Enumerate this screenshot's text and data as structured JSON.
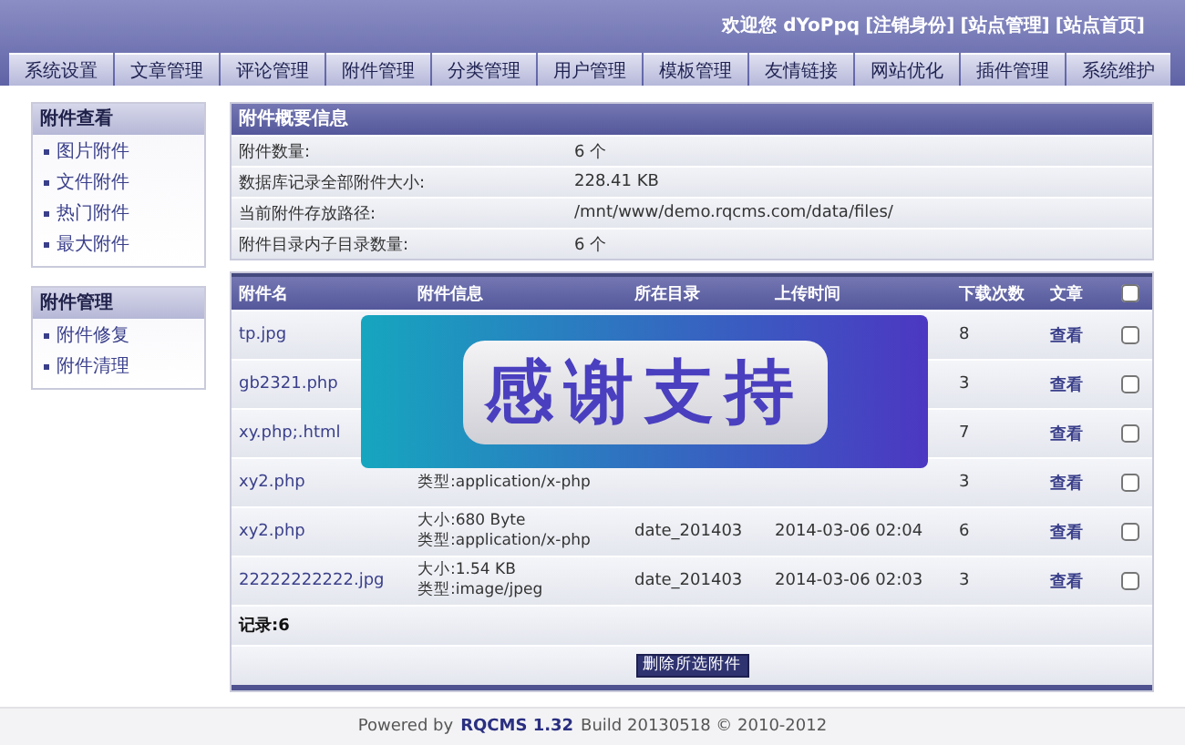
{
  "header": {
    "welcome": "欢迎您 dYoPpq",
    "links": [
      "[注销身份]",
      "[站点管理]",
      "[站点首页]"
    ]
  },
  "nav": [
    "系统设置",
    "文章管理",
    "评论管理",
    "附件管理",
    "分类管理",
    "用户管理",
    "模板管理",
    "友情链接",
    "网站优化",
    "插件管理",
    "系统维护"
  ],
  "sidebar": [
    {
      "title": "附件查看",
      "items": [
        "图片附件",
        "文件附件",
        "热门附件",
        "最大附件"
      ]
    },
    {
      "title": "附件管理",
      "items": [
        "附件修复",
        "附件清理"
      ]
    }
  ],
  "overview": {
    "title": "附件概要信息",
    "rows": [
      {
        "label": "附件数量:",
        "value": "6 个"
      },
      {
        "label": "数据库记录全部附件大小:",
        "value": "228.41 KB"
      },
      {
        "label": "当前附件存放路径:",
        "value": "/mnt/www/demo.rqcms.com/data/files/"
      },
      {
        "label": "附件目录内子目录数量:",
        "value": "6 个"
      }
    ]
  },
  "table": {
    "columns": [
      "附件名",
      "附件信息",
      "所在目录",
      "上传时间",
      "下载次数",
      "文章"
    ],
    "select_all_checked": false,
    "rows": [
      {
        "name": "tp.jpg",
        "info": [],
        "dir": "",
        "time": "",
        "downloads": "8",
        "action": "查看",
        "checked": false
      },
      {
        "name": "gb2321.php",
        "info": [],
        "dir": "",
        "time": "",
        "downloads": "3",
        "action": "查看",
        "checked": false
      },
      {
        "name": "xy.php;.html",
        "info": [],
        "dir": "",
        "time": "",
        "downloads": "7",
        "action": "查看",
        "checked": false
      },
      {
        "name": "xy2.php",
        "info": [
          "类型:application/x-php"
        ],
        "dir": "",
        "time": "",
        "downloads": "3",
        "action": "查看",
        "checked": false
      },
      {
        "name": "xy2.php",
        "info": [
          "大小:680 Byte",
          "类型:application/x-php"
        ],
        "dir": "date_201403",
        "time": "2014-03-06 02:04",
        "downloads": "6",
        "action": "查看",
        "checked": false
      },
      {
        "name": "22222222222.jpg",
        "info": [
          "大小:1.54 KB",
          "类型:image/jpeg"
        ],
        "dir": "date_201403",
        "time": "2014-03-06 02:03",
        "downloads": "3",
        "action": "查看",
        "checked": false
      }
    ],
    "record_count": "记录:6",
    "delete_button": "删除所选附件"
  },
  "overlay": {
    "text": "感谢支持"
  },
  "footer": {
    "prefix": "Powered by",
    "product": "RQCMS 1.32",
    "suffix": "Build 20130518 © 2010-2012"
  }
}
